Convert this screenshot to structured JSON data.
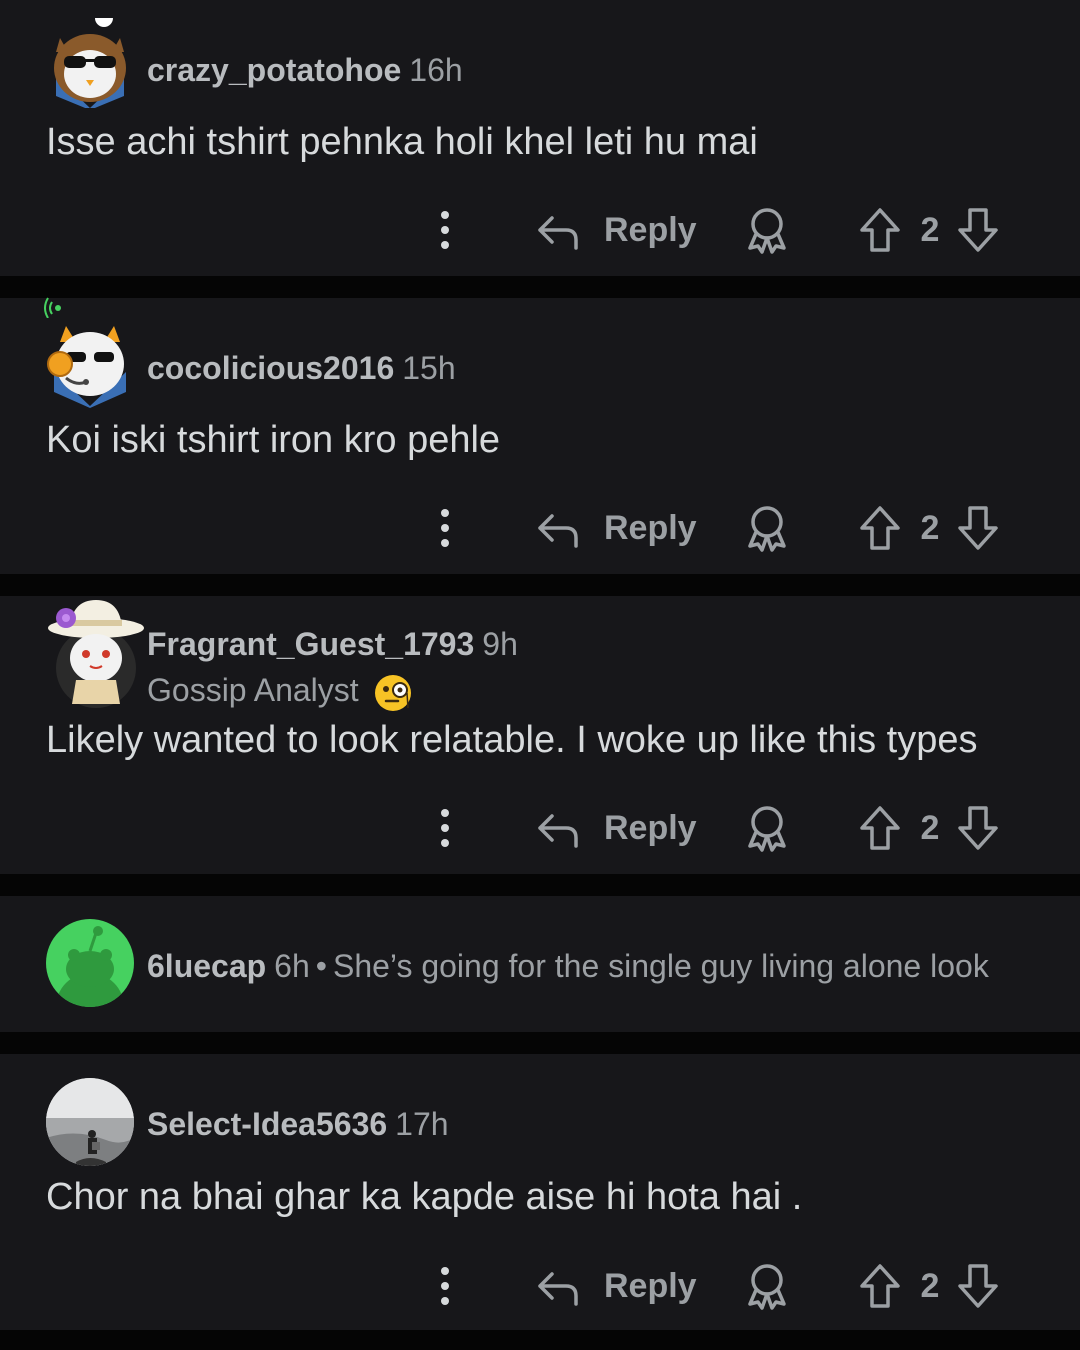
{
  "comments": [
    {
      "username": "crazy_potatohoe",
      "time": "16h",
      "text": "Isse achi tshirt pehnka holi khel leti hu mai",
      "reply_label": "Reply",
      "score": "2",
      "avatar_icon": "snoo-owl-sunglasses-avatar"
    },
    {
      "username": "cocolicious2016",
      "time": "15h",
      "text": "Koi iski tshirt iron kro pehle",
      "reply_label": "Reply",
      "score": "2",
      "avatar_icon": "snoo-fox-headset-avatar"
    },
    {
      "username": "Fragrant_Guest_1793",
      "time": "9h",
      "flair": "Gossip Analyst",
      "flair_emoji": "face-with-monocle",
      "text": "Likely wanted to look relatable. I woke up like this types",
      "reply_label": "Reply",
      "score": "2",
      "avatar_icon": "snoo-sunhat-avatar"
    },
    {
      "username": "6luecap",
      "time": "6h",
      "separator": "•",
      "text": "She’s going for the single guy living alone look",
      "collapsed": true,
      "avatar_icon": "default-green-snoo-avatar"
    },
    {
      "username": "Select-Idea5636",
      "time": "17h",
      "text": "Chor na bhai ghar ka kapde aise hi hota hai .",
      "reply_label": "Reply",
      "score": "2",
      "avatar_icon": "photo-avatar"
    }
  ],
  "colors": {
    "background": "#050505",
    "card": "#17171a",
    "text": "#d7dadc",
    "muted": "#9ca0a4",
    "default_avatar_green": "#46d160"
  }
}
